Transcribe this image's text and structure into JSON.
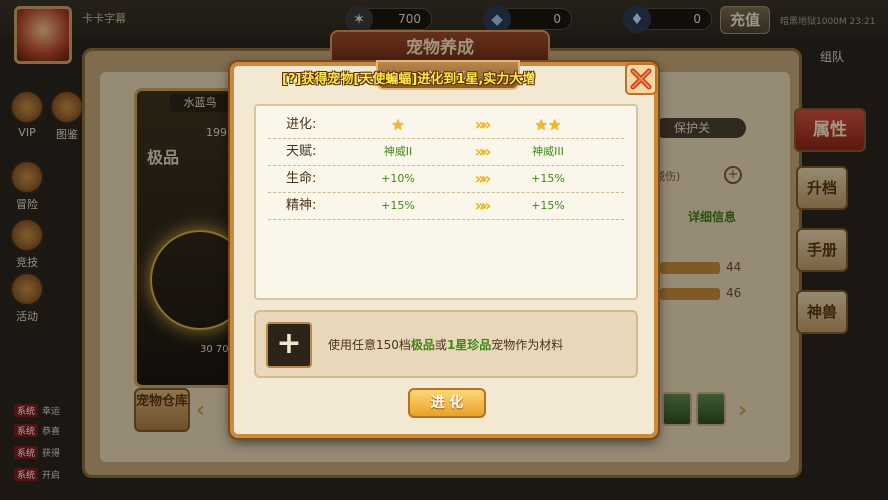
{
  "topbar": {
    "player_name": "卡卡字幕",
    "resources": [
      {
        "icon": "star-coin-icon",
        "value": "700"
      },
      {
        "icon": "ore-icon",
        "value": "0"
      },
      {
        "icon": "diamond-icon",
        "value": "0"
      }
    ],
    "recharge_label": "充值",
    "right_text": "暗黑地狱1000M    23:21"
  },
  "sidebar": {
    "items": [
      {
        "label": "VIP"
      },
      {
        "label": "图鉴"
      },
      {
        "label": "冒险"
      },
      {
        "label": "竞技"
      },
      {
        "label": "活动"
      }
    ]
  },
  "chat": [
    {
      "tag": "系统",
      "text": "幸运"
    },
    {
      "tag": "系统",
      "text": "恭喜"
    },
    {
      "tag": "系统",
      "text": "获得"
    },
    {
      "tag": "系统",
      "text": "开启"
    }
  ],
  "background": {
    "title": "宠物养成",
    "pet_name": "水蓝鸟",
    "pet_level": "199",
    "pet_grade": "极品",
    "pet_stats_short": "30   70",
    "warehouse_label": "宠物仓库",
    "protect_label": "保护关",
    "reduce_label": "减伤)",
    "detail_link": "详细信息",
    "bar_values": [
      "44",
      "46"
    ],
    "far_right_text": "组队",
    "right_tabs": [
      {
        "label": "属性",
        "active": true
      },
      {
        "label": "升档",
        "active": false
      },
      {
        "label": "手册",
        "active": false
      },
      {
        "label": "神兽",
        "active": false
      }
    ]
  },
  "modal": {
    "tab_title": "宠物进化",
    "announcement": "[?]获得宠物[天使蝙蝠]进化到1星,实力大增",
    "rows": [
      {
        "label": "进化:",
        "from": "",
        "to": "",
        "from_stars": 1,
        "to_stars": 2
      },
      {
        "label": "天赋:",
        "from": "神威II",
        "to": "神威III"
      },
      {
        "label": "生命:",
        "from": "+10%",
        "to": "+15%"
      },
      {
        "label": "精神:",
        "from": "+15%",
        "to": "+15%"
      }
    ],
    "arrow_glyph": "»»",
    "material": {
      "prefix": "使用任意150档",
      "highlight1": "极品",
      "middle": "或",
      "highlight2": "1星珍品",
      "suffix": "宠物作为材料"
    },
    "add_symbol": "+",
    "evolve_label": "进 化"
  }
}
